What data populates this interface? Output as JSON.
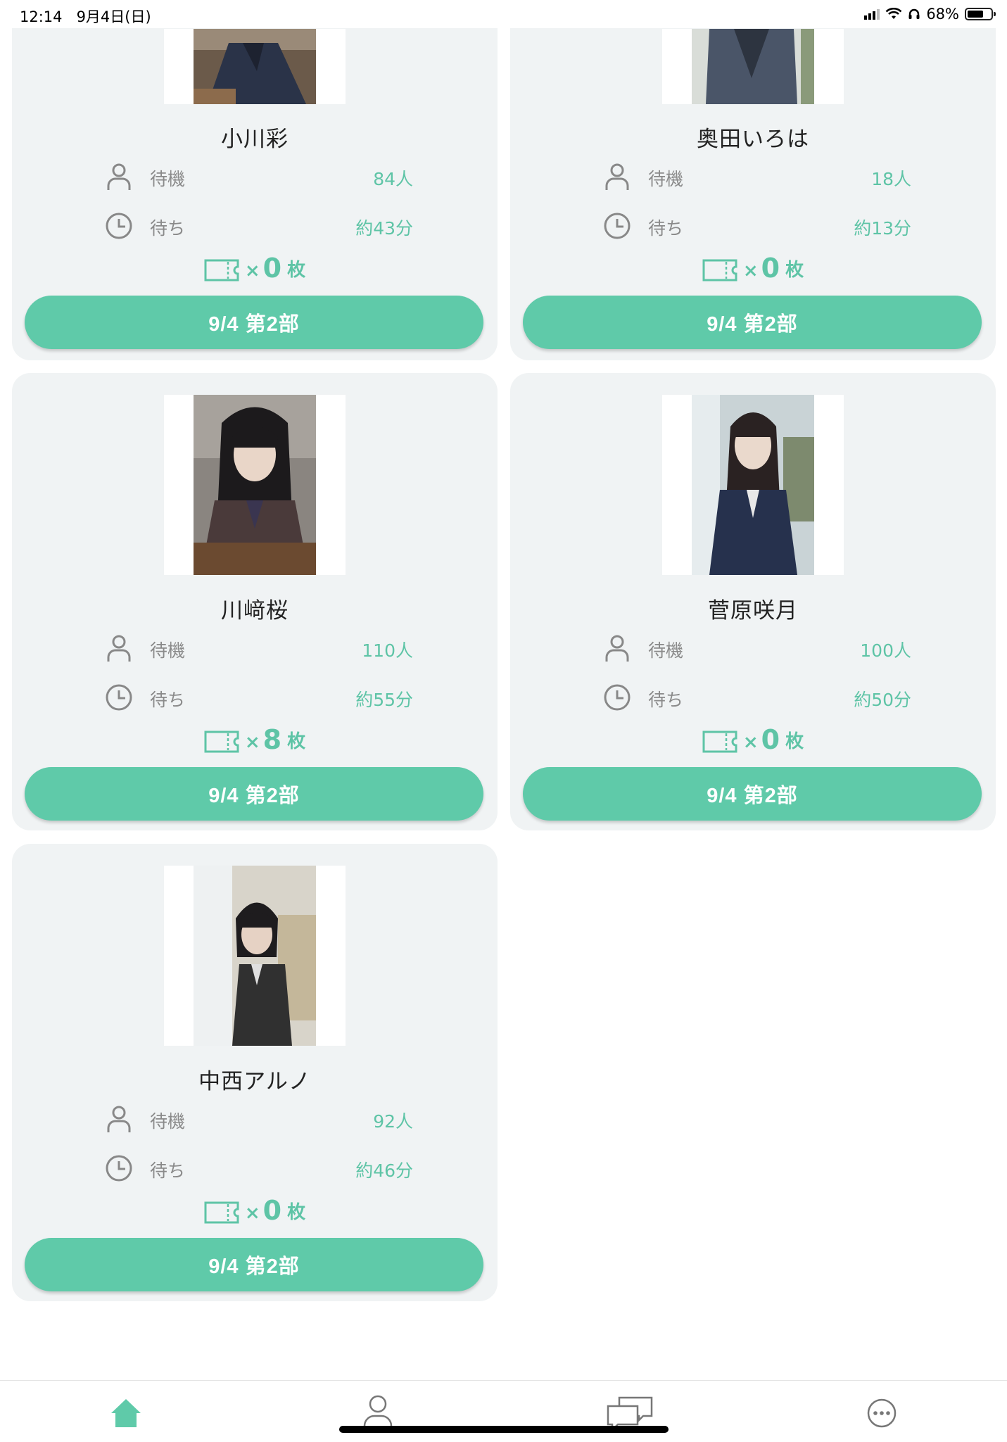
{
  "status_bar": {
    "time": "12:14",
    "date": "9月4日(日)",
    "battery": "68%",
    "battery_level": 0.68
  },
  "labels": {
    "waiting": "待機",
    "wait_time": "待ち",
    "ticket_x": "×",
    "ticket_unit": "枚"
  },
  "colors": {
    "accent": "#5fcaa9",
    "card_bg": "#f0f3f4",
    "value_text": "#5ec4a6"
  },
  "members": [
    {
      "name": "小川彩",
      "waiting": "84人",
      "wait_time": "約43分",
      "tickets": "0",
      "button": "9/4 第2部",
      "photo": "partial-photo"
    },
    {
      "name": "奥田いろは",
      "waiting": "18人",
      "wait_time": "約13分",
      "tickets": "0",
      "button": "9/4 第2部",
      "photo": "partial-photo"
    },
    {
      "name": "川﨑桜",
      "waiting": "110人",
      "wait_time": "約55分",
      "tickets": "8",
      "button": "9/4 第2部",
      "photo": "member-photo"
    },
    {
      "name": "菅原咲月",
      "waiting": "100人",
      "wait_time": "約50分",
      "tickets": "0",
      "button": "9/4 第2部",
      "photo": "member-photo"
    },
    {
      "name": "中西アルノ",
      "waiting": "92人",
      "wait_time": "約46分",
      "tickets": "0",
      "button": "9/4 第2部",
      "photo": "member-photo"
    }
  ],
  "tabs": [
    {
      "icon": "home-icon",
      "active": true
    },
    {
      "icon": "profile-icon",
      "active": false
    },
    {
      "icon": "chat-icon",
      "active": false
    },
    {
      "icon": "more-icon",
      "active": false
    }
  ]
}
